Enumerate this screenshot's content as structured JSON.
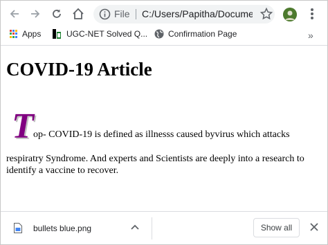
{
  "toolbar": {
    "security_label": "File",
    "url": "C:/Users/Papitha/Docume..."
  },
  "bookmarks": {
    "items": [
      {
        "label": "Apps"
      },
      {
        "label": "UGC-NET Solved Q..."
      },
      {
        "label": "Confirmation Page"
      }
    ],
    "more": "»"
  },
  "page": {
    "title": "COVID-19 Article",
    "drop_cap": "T",
    "first_line": "op- COVID-19 is defined as illnesss caused byvirus which attacks",
    "rest_text": "respiratry Syndrome. And experts and Scientists are deeply into a research to identify a vaccine to recover."
  },
  "downloads": {
    "file_name": "bullets blue.png",
    "show_all_label": "Show all"
  },
  "colors": {
    "drop_cap": "#800080",
    "omnibox_bg": "#f1f3f4"
  }
}
